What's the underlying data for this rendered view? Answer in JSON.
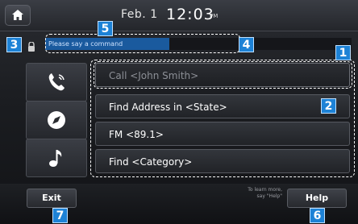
{
  "status_bar": {
    "date": "Feb.  1",
    "time": "12:03",
    "ampm": "PM"
  },
  "prompt": {
    "text": "Please say a command"
  },
  "side_icons": [
    "phone-icon",
    "navigation-icon",
    "music-icon"
  ],
  "commands": [
    "Call <John Smith>",
    "Find Address in <State>",
    "FM <89.1>",
    "Find <Category>"
  ],
  "bottom": {
    "exit_label": "Exit",
    "help_label": "Help",
    "hint_line1": "To learn more,",
    "hint_line2": "say \"Help\""
  },
  "markers": [
    "1",
    "2",
    "3",
    "4",
    "5",
    "6",
    "7"
  ],
  "colors": {
    "marker": "#1d82d6",
    "prompt_bg": "#1a5a9e"
  }
}
